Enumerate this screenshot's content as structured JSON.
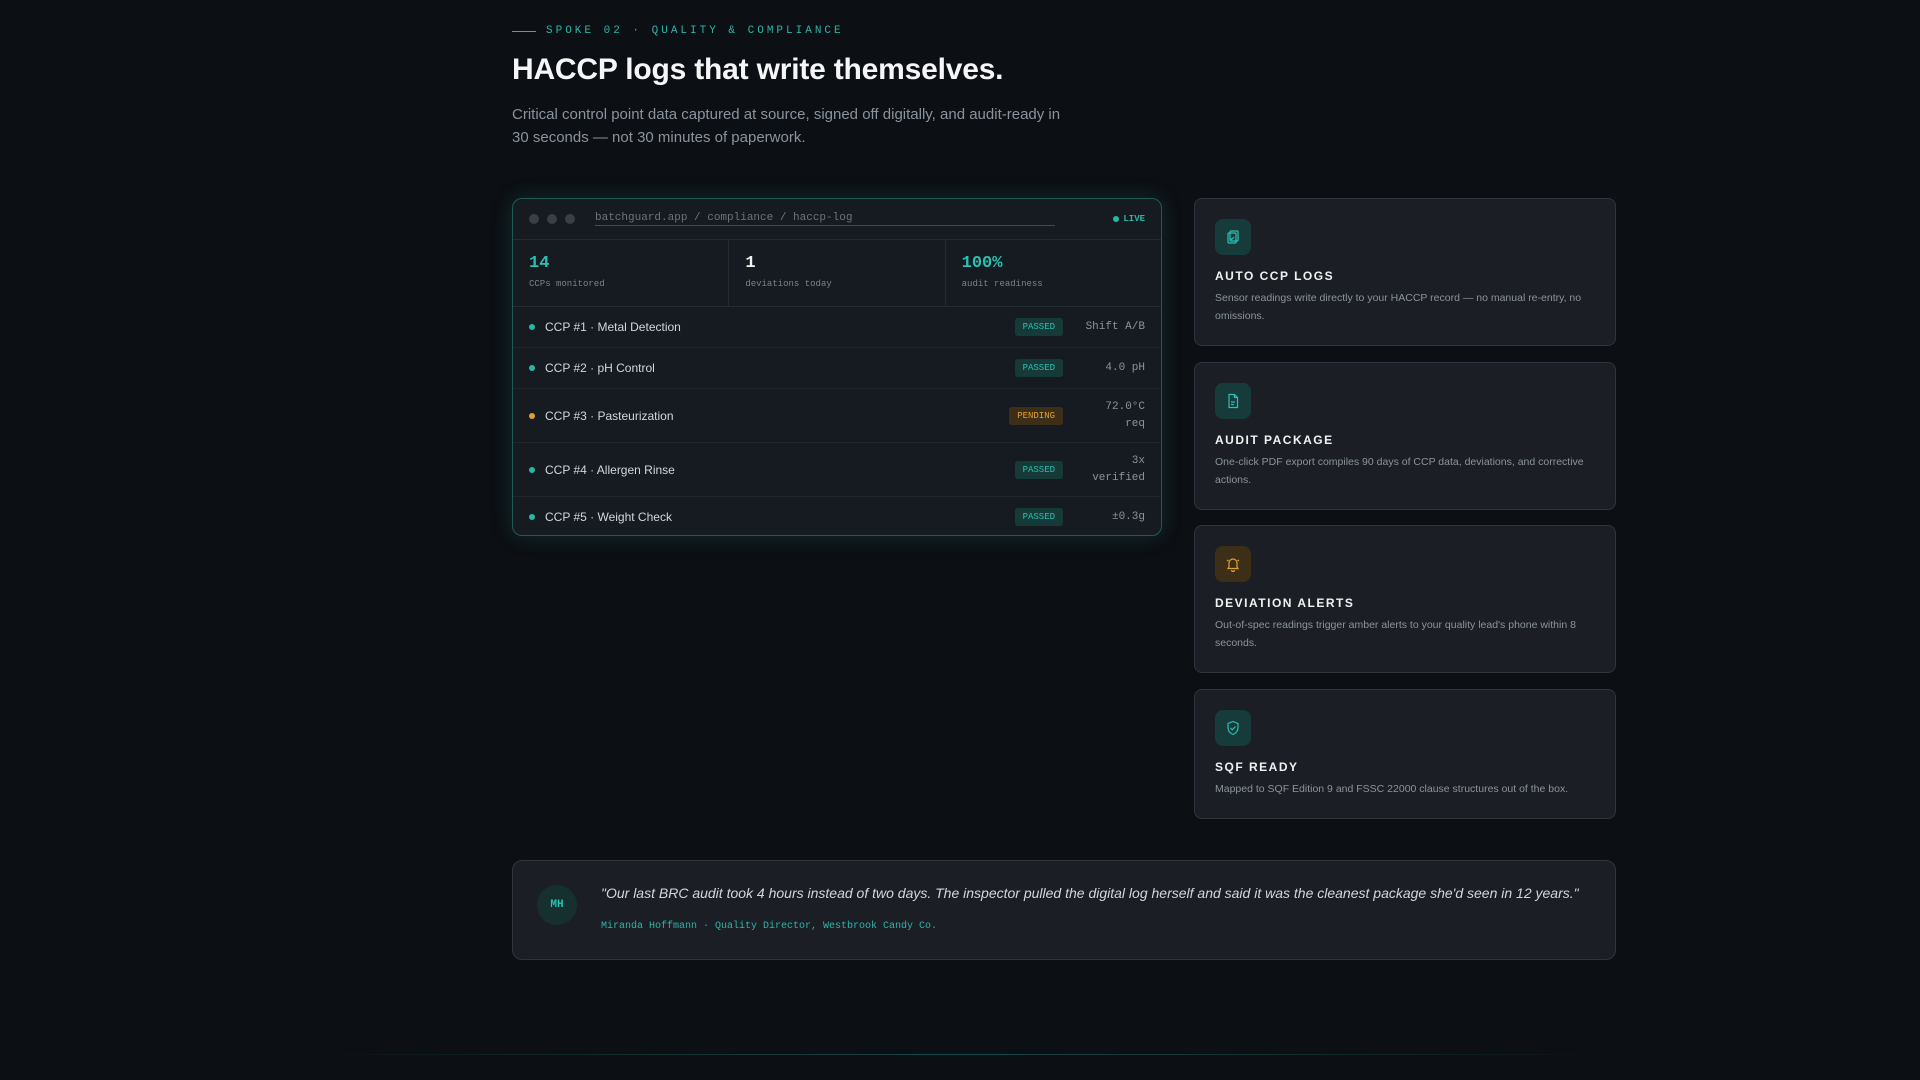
{
  "header": {
    "eyebrow": "SPOKE 02 · QUALITY & COMPLIANCE",
    "title": "HACCP logs that write themselves.",
    "subtitle": "Critical control point data captured at source, signed off digitally, and audit-ready in 30 seconds — not 30 minutes of paperwork."
  },
  "dashboard": {
    "url": "batchguard.app / compliance / haccp-log",
    "live_label": "LIVE",
    "stats": [
      {
        "value": "14",
        "label": "CCPs monitored"
      },
      {
        "value": "1",
        "label": "deviations today"
      },
      {
        "value": "100%",
        "label": "audit readiness"
      }
    ],
    "rows": [
      {
        "name": "CCP #1 · Metal Detection",
        "status": "PASSED",
        "value": "Shift A/B"
      },
      {
        "name": "CCP #2 · pH Control",
        "status": "PASSED",
        "value": "4.0 pH"
      },
      {
        "name": "CCP #3 · Pasteurization",
        "status": "PENDING",
        "value": "72.0°C req"
      },
      {
        "name": "CCP #4 · Allergen Rinse",
        "status": "PASSED",
        "value": "3x verified"
      },
      {
        "name": "CCP #5 · Weight Check",
        "status": "PASSED",
        "value": "±0.3g"
      }
    ]
  },
  "features": [
    {
      "icon": "clipboard-copy-icon",
      "title": "AUTO CCP LOGS",
      "desc": "Sensor readings write directly to your HACCP record — no manual re-entry, no omissions."
    },
    {
      "icon": "document-icon",
      "title": "AUDIT PACKAGE",
      "desc": "One-click PDF export compiles 90 days of CCP data, deviations, and corrective actions."
    },
    {
      "icon": "bell-icon",
      "title": "DEVIATION ALERTS",
      "desc": "Out-of-spec readings trigger amber alerts to your quality lead's phone within 8 seconds."
    },
    {
      "icon": "shield-check-icon",
      "title": "SQF READY",
      "desc": "Mapped to SQF Edition 9 and FSSC 22000 clause structures out of the box."
    }
  ],
  "testimonial": {
    "initials": "MH",
    "quote": "\"Our last BRC audit took 4 hours instead of two days. The inspector pulled the digital log herself and said it was the cleanest package she'd seen in 12 years.\"",
    "author": "Miranda Hoffmann · Quality Director, Westbrook Candy Co."
  },
  "colors": {
    "accent": "#2bb5a8",
    "pending": "#e0a030",
    "background": "#0c0f14"
  }
}
